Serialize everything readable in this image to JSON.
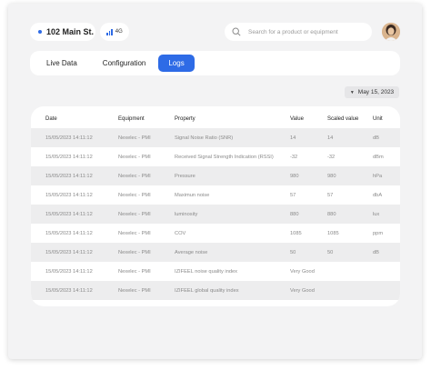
{
  "header": {
    "location": "102 Main St.",
    "network": "4G",
    "search_placeholder": "Search for a product or equipment"
  },
  "tabs": [
    {
      "label": "Live Data",
      "active": false
    },
    {
      "label": "Configuration",
      "active": false
    },
    {
      "label": "Logs",
      "active": true
    }
  ],
  "date_filter": "May 15, 2023",
  "table": {
    "columns": [
      "Date",
      "Equipment",
      "Property",
      "Value",
      "Scaled value",
      "Unit"
    ],
    "rows": [
      [
        "15/05/2023  14:11:12",
        "Nexelec - PMI",
        "Signal Noise Ratio (SNR)",
        "14",
        "14",
        "dB"
      ],
      [
        "15/05/2023  14:11:12",
        "Nexelec - PMI",
        "Received Signal Strength Indication (RSSI)",
        "-32",
        "-32",
        "dBm"
      ],
      [
        "15/05/2023  14:11:12",
        "Nexelec - PMI",
        "Pressure",
        "980",
        "980",
        "hPa"
      ],
      [
        "15/05/2023  14:11:12",
        "Nexelec - PMI",
        "Maximun noise",
        "57",
        "57",
        "dbA"
      ],
      [
        "15/05/2023  14:11:12",
        "Nexelec - PMI",
        "luminosity",
        "880",
        "880",
        "lux"
      ],
      [
        "15/05/2023  14:11:12",
        "Nexelec - PMI",
        "COV",
        "1085",
        "1085",
        "ppm"
      ],
      [
        "15/05/2023  14:11:12",
        "Nexelec - PMI",
        "Average noise",
        "50",
        "50",
        "dB"
      ],
      [
        "15/05/2023  14:11:12",
        "Nexelec - PMI",
        "IZIFEEL noise quality index",
        "Very Good",
        "",
        ""
      ],
      [
        "15/05/2023  14:11:12",
        "Nexelec - PMI",
        "IZIFEEL global quality index",
        "Very Good",
        "",
        ""
      ]
    ]
  },
  "colors": {
    "accent": "#2e6be6",
    "background": "#f3f3f4",
    "row_stripe": "#ededee"
  },
  "icons": [
    "location-dot-icon",
    "signal-icon",
    "search-icon",
    "user-avatar",
    "caret-down-icon"
  ]
}
